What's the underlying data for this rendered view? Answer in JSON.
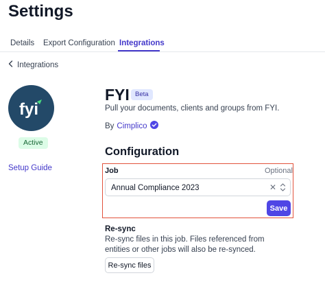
{
  "page": {
    "title": "Settings"
  },
  "tabs": [
    {
      "label": "Details",
      "active": false
    },
    {
      "label": "Export Configuration",
      "active": false
    },
    {
      "label": "Integrations",
      "active": true
    }
  ],
  "breadcrumb": {
    "back_label": "Integrations",
    "icon": "chevron-left-icon"
  },
  "sidebar": {
    "logo_text": "fyi",
    "status": "Active",
    "setup_guide": "Setup Guide"
  },
  "app": {
    "name": "FYI",
    "badge": "Beta",
    "description": "Pull your documents, clients and groups from FYI.",
    "by_prefix": "By",
    "vendor": "Cimplico",
    "verified_icon": "check-circle-icon"
  },
  "configuration": {
    "title": "Configuration",
    "job": {
      "label": "Job",
      "optional_text": "Optional",
      "value": "Annual Compliance 2023",
      "clear_icon": "close-icon",
      "toggle_icon": "chevron-updown-icon"
    },
    "save_label": "Save"
  },
  "resync": {
    "title": "Re-sync",
    "description": "Re-sync files in this job. Files referenced from entities or other jobs will also be re-synced.",
    "button_label": "Re-sync files"
  },
  "colors": {
    "accent": "#4f46e5",
    "logo_bg": "#234968",
    "highlight_border": "#e2523b",
    "status_bg": "#dcfce7"
  }
}
